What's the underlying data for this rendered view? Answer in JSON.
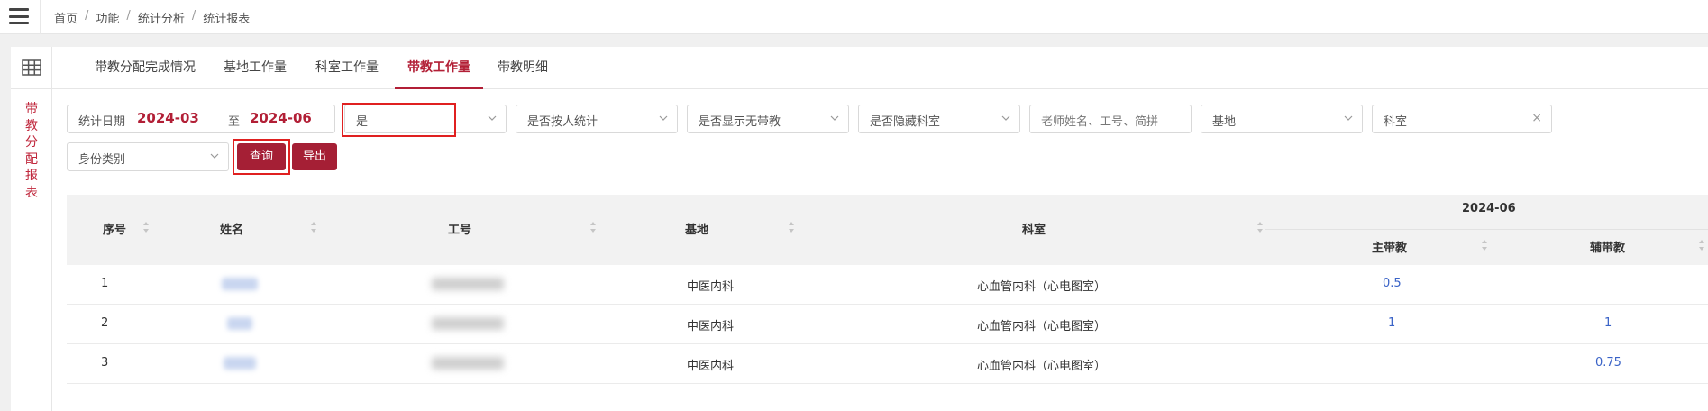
{
  "breadcrumb": [
    "首页",
    "功能",
    "统计分析",
    "统计报表"
  ],
  "sidebar": {
    "vertical_label": [
      "带",
      "教",
      "分",
      "配",
      "报",
      "表"
    ]
  },
  "tabs": [
    {
      "label": "带教分配完成情况",
      "active": false
    },
    {
      "label": "基地工作量",
      "active": false
    },
    {
      "label": "科室工作量",
      "active": false
    },
    {
      "label": "带教工作量",
      "active": true
    },
    {
      "label": "带教明细",
      "active": false
    }
  ],
  "filters": {
    "date_label": "统计日期",
    "date_start": "2024-03",
    "date_to": "至",
    "date_end": "2024-06",
    "select_yes": "是",
    "by_person": "是否按人统计",
    "show_no_teaching": "是否显示无带教",
    "hide_dept": "是否隐藏科室",
    "teacher_placeholder": "老师姓名、工号、简拼",
    "base": "基地",
    "dept": "科室",
    "identity": "身份类别",
    "clear_icon": "×"
  },
  "buttons": {
    "query": "查询",
    "export": "导出"
  },
  "table": {
    "headers": {
      "seq": "序号",
      "name": "姓名",
      "id": "工号",
      "base": "基地",
      "dept": "科室",
      "month": "2024-06",
      "main": "主带教",
      "assist": "辅带教"
    },
    "rows": [
      {
        "seq": "1",
        "base": "中医内科",
        "dept": "心血管内科（心电图室）",
        "main": "0.5",
        "assist": ""
      },
      {
        "seq": "2",
        "base": "中医内科",
        "dept": "心血管内科（心电图室）",
        "main": "1",
        "assist": "1"
      },
      {
        "seq": "3",
        "base": "中医内科",
        "dept": "心血管内科（心电图室）",
        "main": "",
        "assist": "0.75"
      }
    ]
  },
  "colors": {
    "accent": "#a51f35",
    "link_number": "#3a63c7",
    "highlight_box": "#e02020"
  }
}
